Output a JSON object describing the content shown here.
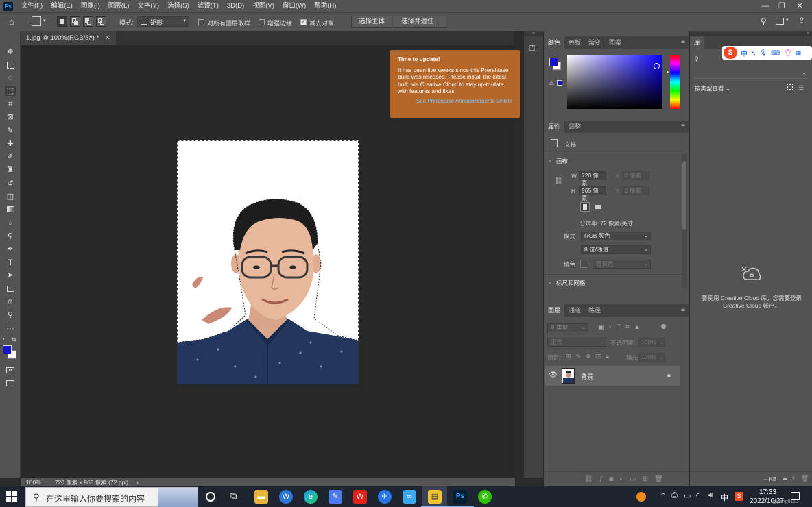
{
  "menubar": {
    "logo": "Ps",
    "items": [
      "文件(F)",
      "编辑(E)",
      "图像(I)",
      "图层(L)",
      "文字(Y)",
      "选择(S)",
      "滤镜(T)",
      "3D(D)",
      "视图(V)",
      "窗口(W)",
      "帮助(H)"
    ],
    "window_controls": [
      "—",
      "❐",
      "✕"
    ]
  },
  "options": {
    "mode_label": "模式:",
    "mode_value": "矩形",
    "sample_all_layers": "对所有图层取样",
    "enhance_edge": "增强边缘",
    "subtract_object": "减去对象",
    "select_subject": "选择主体",
    "select_and_mask": "选择并遮住..."
  },
  "document": {
    "tab_title": "1.jpg @ 100%(RGB/8#) *",
    "zoom": "100%",
    "info": "720 像素 x 965 像素 (72 ppi)"
  },
  "notice": {
    "title": "Time to update!",
    "body": "It has been five weeks since this Prerelease build was released. Please install the latest build via Creative Cloud to stay up-to-date with features and fixes.",
    "link": "See Prerelease Announcements Online"
  },
  "color_panel": {
    "tabs": [
      "颜色",
      "色板",
      "渐变",
      "图案"
    ],
    "foreground": "#1a14c8",
    "background": "#ffffff"
  },
  "properties_panel": {
    "tabs": [
      "属性",
      "调整"
    ],
    "doc_label": "文档",
    "canvas_section": "画布",
    "w_label": "W",
    "w_value": "720 像素",
    "h_label": "H",
    "h_value": "965 像素",
    "x_label": "X",
    "x_value": "0 像素",
    "y_label": "Y",
    "y_value": "0 像素",
    "resolution": "分辨率: 72 像素/英寸",
    "mode_label": "模式",
    "mode_value": "RGB 颜色",
    "depth_value": "8 位/通道",
    "fill_label": "填色",
    "fill_value": "背景色",
    "rulers_section": "标尺和网格"
  },
  "layers_panel": {
    "tabs": [
      "图层",
      "通道",
      "路径"
    ],
    "kind_placeholder": "类型",
    "blend_mode": "正常",
    "opacity_label": "不透明度:",
    "opacity_value": "100%",
    "lock_label": "锁定:",
    "fill_label": "填充:",
    "fill_value": "100%",
    "layer_name": "背景"
  },
  "library_panel": {
    "tab": "库",
    "view_by": "按类型查看",
    "message": "要使用 Creative Cloud 库，您需要登录 Creative Cloud 帐户。",
    "size": "-- KB"
  },
  "ime_bar": {
    "logo": "S",
    "lang": "中"
  },
  "taskbar": {
    "search_placeholder": "在这里输入你要搜索的内容",
    "time": "17:33",
    "date": "2022/10/27",
    "ime": "中",
    "watermark": "@pang8110"
  }
}
